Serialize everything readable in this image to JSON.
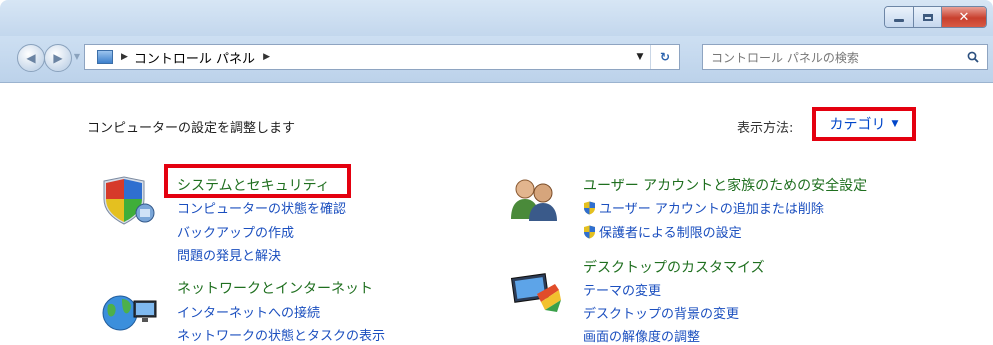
{
  "window": {
    "breadcrumb": [
      "コントロール パネル"
    ],
    "search": {
      "placeholder": "コントロール パネルの検索"
    }
  },
  "icons": {
    "back": "back-arrow-icon",
    "forward": "forward-arrow-icon",
    "refresh": "refresh-icon",
    "search": "search-icon"
  },
  "header": {
    "heading": "コンピューターの設定を調整します",
    "view_by_label": "表示方法:",
    "view_by_value": "カテゴリ"
  },
  "categories": [
    {
      "title": "システムとセキュリティ",
      "links": [
        "コンピューターの状態を確認",
        "バックアップの作成",
        "問題の発見と解決"
      ]
    },
    {
      "title": "ネットワークとインターネット",
      "links": [
        "インターネットへの接続",
        "ネットワークの状態とタスクの表示"
      ]
    },
    {
      "title": "ユーザー アカウントと家族のための安全設定",
      "links": [
        "ユーザー アカウントの追加または削除",
        "保護者による制限の設定"
      ]
    },
    {
      "title": "デスクトップのカスタマイズ",
      "links": [
        "テーマの変更",
        "デスクトップの背景の変更",
        "画面の解像度の調整"
      ]
    }
  ],
  "colors": {
    "highlight": "#e4000f",
    "category_title": "#1f6f1f",
    "link": "#1b4fbf"
  }
}
